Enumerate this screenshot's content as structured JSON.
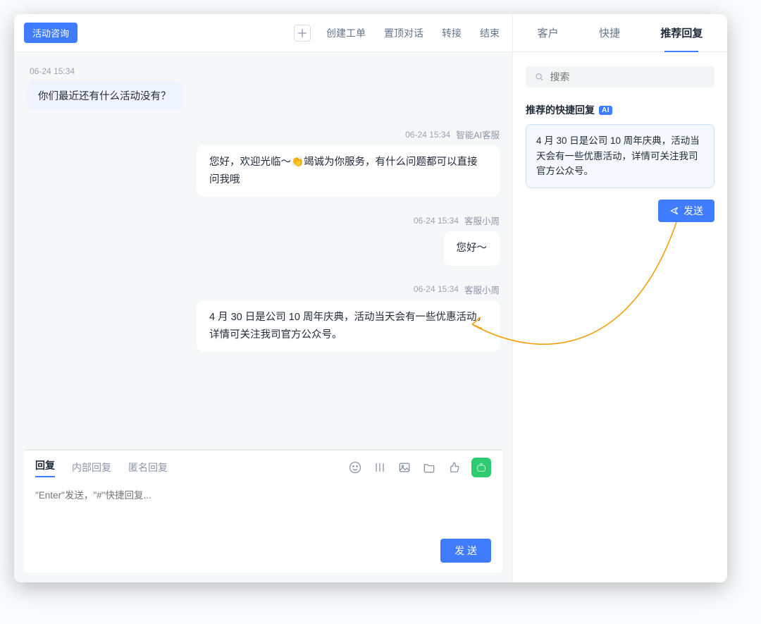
{
  "chat": {
    "tag": "活动咨询",
    "topbar": {
      "create_ticket": "创建工单",
      "pin_chat": "置顶对话",
      "transfer": "转接",
      "end": "结束"
    },
    "messages": {
      "m1": {
        "time": "06-24 15:34",
        "text": "你们最近还有什么活动没有？"
      },
      "m2": {
        "time": "06-24 15:34",
        "who": "智能AI客服",
        "text": "您好，欢迎光临～👏竭诚为你服务，有什么问题都可以直接问我哦"
      },
      "m3": {
        "time": "06-24 15:34",
        "who": "客服小周",
        "text": "您好～"
      },
      "m4": {
        "time": "06-24 15:34",
        "who": "客服小周",
        "text": "4 月 30 日是公司 10 周年庆典，活动当天会有一些优惠活动，详情可关注我司官方公众号。"
      }
    },
    "replybox": {
      "tab_reply": "回复",
      "tab_internal": "内部回复",
      "tab_anon": "匿名回复",
      "placeholder": "\"Enter\"发送，\"#\"快捷回复...",
      "send": "发 送"
    }
  },
  "side": {
    "tabs": {
      "customer": "客户",
      "quick": "快捷",
      "suggest": "推荐回复"
    },
    "search_placeholder": "搜索",
    "heading": "推荐的快捷回复",
    "ai_badge": "AI",
    "suggestion": "4 月 30 日是公司 10 周年庆典，活动当天会有一些优惠活动，详情可关注我司官方公众号。",
    "send": "发送"
  }
}
